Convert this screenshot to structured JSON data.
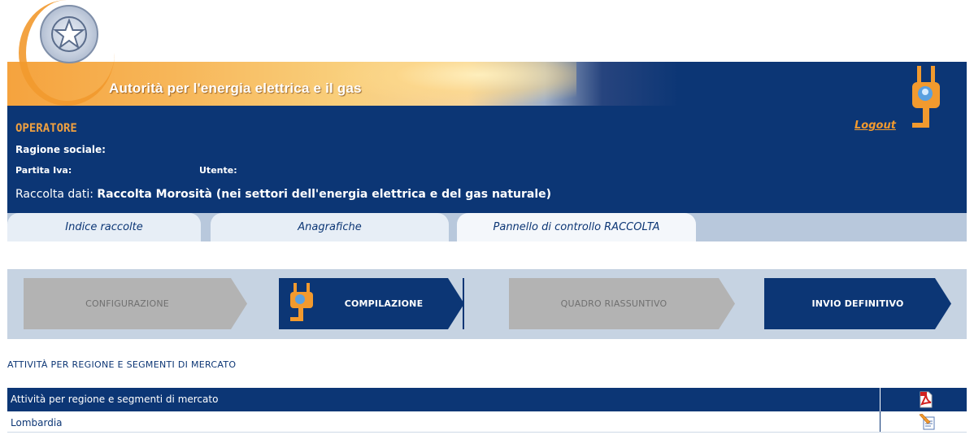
{
  "header": {
    "banner_title": "Autorità per l'energia elettrica e il gas",
    "logout_label": "Logout"
  },
  "operator": {
    "title": "OPERATORE",
    "ragione_sociale_label": "Ragione sociale:",
    "partita_iva_label": "Partita Iva:",
    "utente_label": "Utente:",
    "raccolta_label": "Raccolta dati:",
    "raccolta_value": "Raccolta Morosità (nei settori dell'energia elettrica e del gas naturale)"
  },
  "tabs": [
    {
      "label": "Indice raccolte"
    },
    {
      "label": "Anagrafiche"
    },
    {
      "label": "Pannello di controllo RACCOLTA"
    }
  ],
  "steps": [
    {
      "label": "CONFIGURAZIONE",
      "state": "disabled"
    },
    {
      "label": "COMPILAZIONE",
      "state": "active"
    },
    {
      "label": "QUADRO RIASSUNTIVO",
      "state": "disabled"
    },
    {
      "label": "INVIO DEFINITIVO",
      "state": "active"
    }
  ],
  "section": {
    "title": "ATTIVITÀ PER REGIONE E SEGMENTI DI MERCATO",
    "table_header": "Attività per regione e segmenti di mercato",
    "header_icon": "pdf-icon",
    "rows": [
      {
        "label": "Lombardia",
        "icon": "edit-icon"
      }
    ]
  },
  "colors": {
    "navy": "#0c3675",
    "orange": "#f29a2e",
    "step_disabled": "#b3b3b3",
    "tabbar": "#b8c8dc"
  }
}
